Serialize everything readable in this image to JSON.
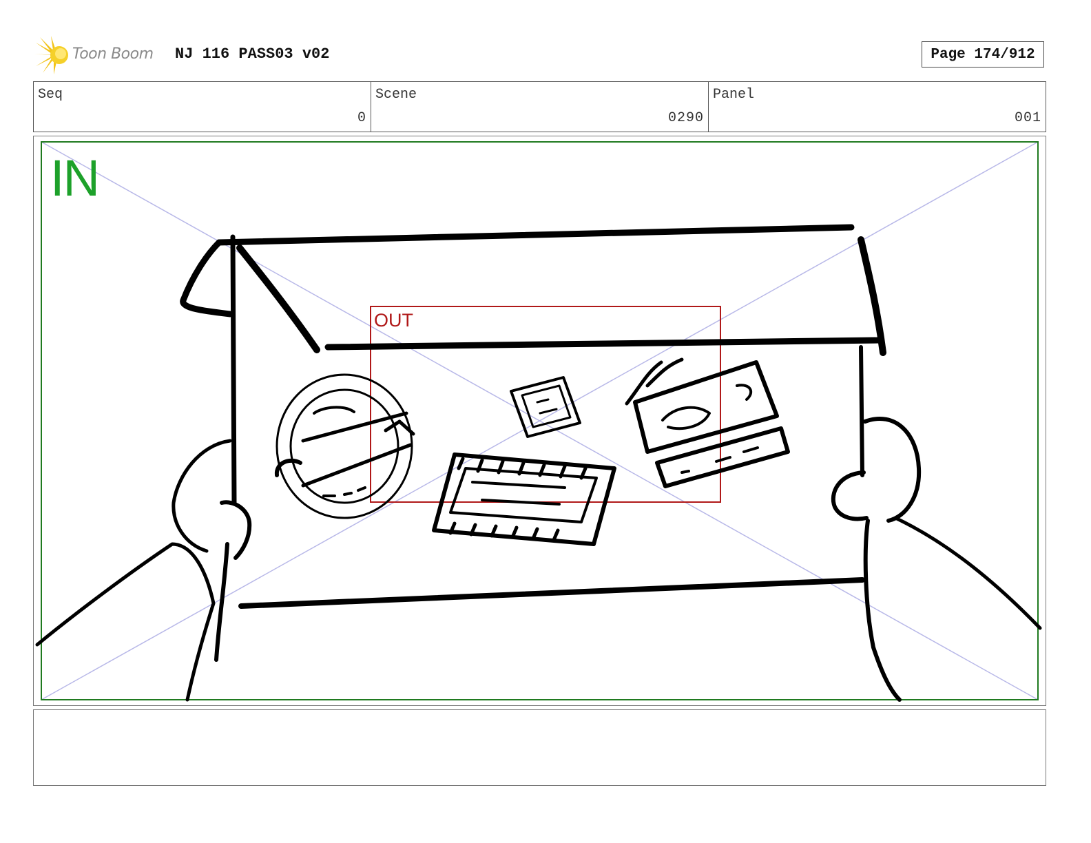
{
  "header": {
    "logo_text": "Toon Boom",
    "project_title": "NJ 116 PASS03 v02",
    "page_label": "Page 174/912"
  },
  "info": {
    "seq": {
      "label": "Seq",
      "value": "0"
    },
    "scene": {
      "label": "Scene",
      "value": "0290"
    },
    "panel": {
      "label": "Panel",
      "value": "001"
    }
  },
  "panel": {
    "in_label": "IN",
    "out_label": "OUT",
    "colors": {
      "in_frame": "#1f7a1f",
      "in_text": "#1da12a",
      "out_frame": "#b01818",
      "diagonals": "#b8b8e8"
    }
  },
  "notes": {
    "text": ""
  }
}
